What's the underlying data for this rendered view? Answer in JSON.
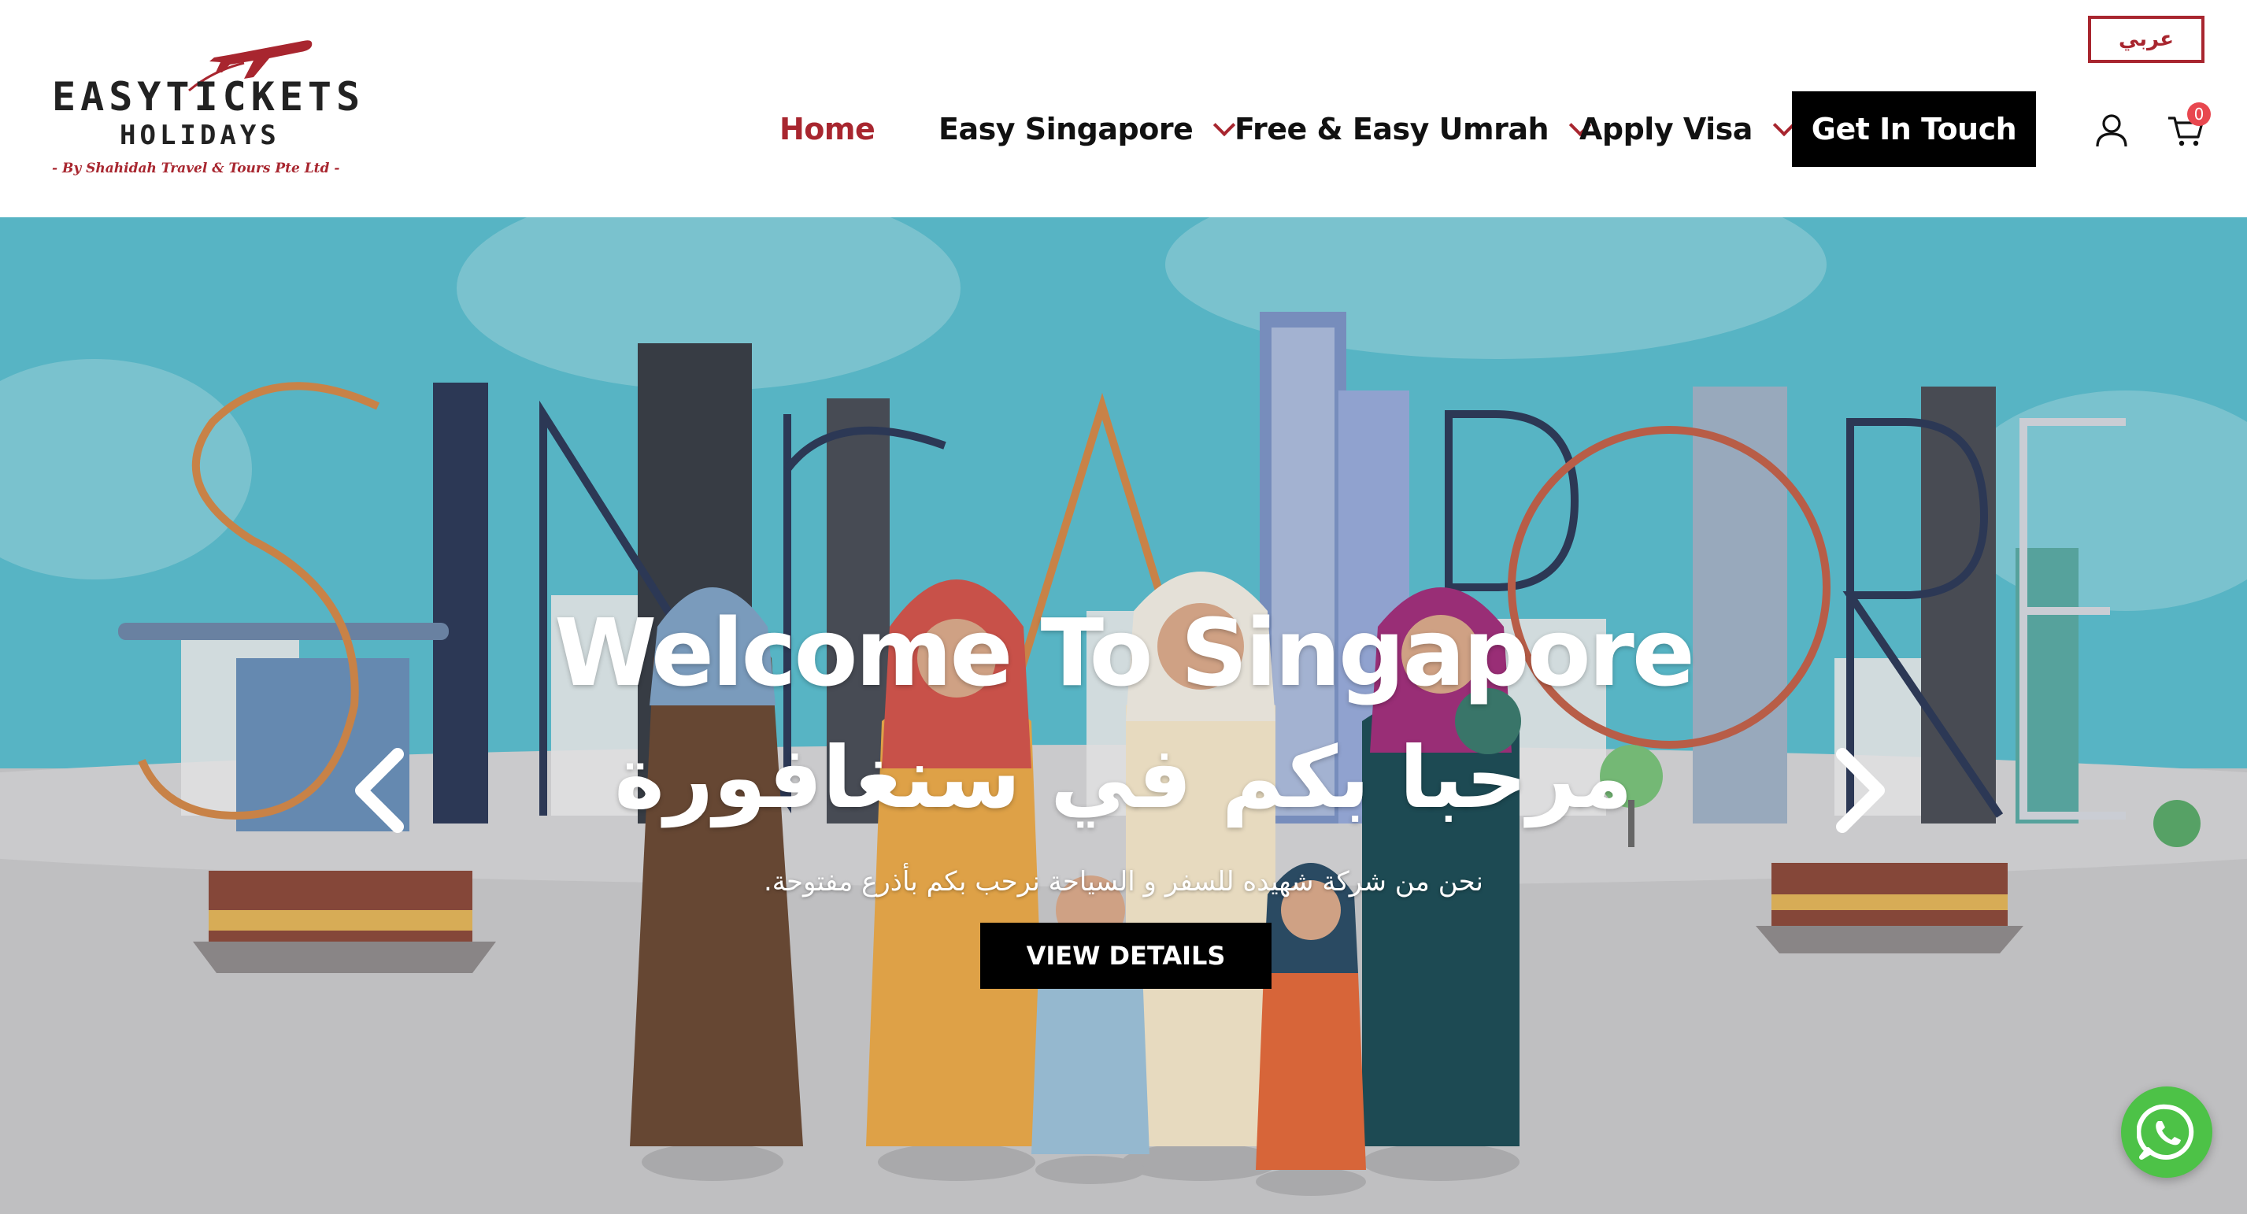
{
  "logo": {
    "line1": "EASYTICKETS",
    "line2": "HOLIDAYS",
    "tagline": "- By Shahidah Travel & Tours Pte Ltd -"
  },
  "header": {
    "language_label": "عربي",
    "nav": [
      {
        "label": "Home",
        "active": true,
        "dropdown": false
      },
      {
        "label": "Easy Singapore",
        "active": false,
        "dropdown": true
      },
      {
        "label": "Free & Easy Umrah",
        "active": false,
        "dropdown": true
      },
      {
        "label": "Apply Visa",
        "active": false,
        "dropdown": true
      }
    ],
    "cta_label": "Get In Touch",
    "cart_count": "0",
    "icons": [
      "user-icon",
      "cart-icon"
    ]
  },
  "hero": {
    "background_word": "SINGAPORE",
    "title": "Welcome To Singapore",
    "title_arabic": "مرحبا بكم في سنغافورة",
    "subtitle_arabic": "نحن من شركة شهيده للسفر و السياحة نرحب بكم بأذرع مفتوحة.",
    "button_label": "VIEW DETAILS",
    "arrows": [
      "chevron-left-icon",
      "chevron-right-icon"
    ]
  },
  "floating": {
    "whatsapp": "whatsapp-icon"
  },
  "colors": {
    "accent": "#a8262f",
    "sky": "#5bbccc",
    "ground": "#c7c7c9",
    "black": "#000000",
    "whatsapp": "#4dc247"
  }
}
